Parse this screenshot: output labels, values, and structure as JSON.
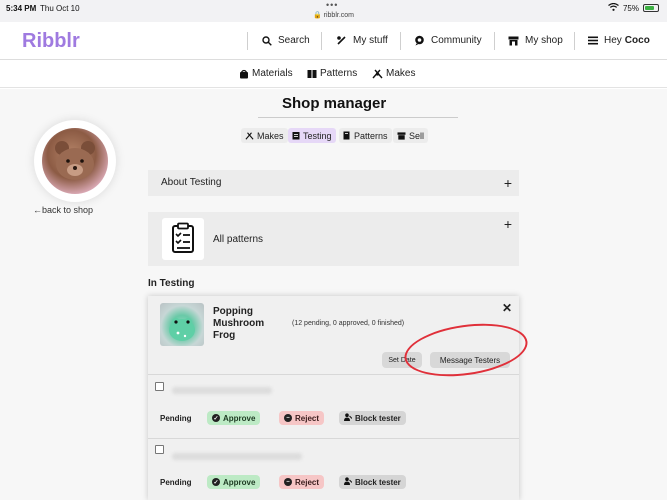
{
  "statusbar": {
    "time": "5:34 PM",
    "date": "Thu Oct 10",
    "url": "ribblr.com",
    "battery": "75%",
    "battery_level": 0.75
  },
  "topnav": {
    "logo": "Ribblr",
    "search": "Search",
    "my_stuff": "My stuff",
    "community": "Community",
    "my_shop": "My shop",
    "hey": "Hey",
    "user": "Coco"
  },
  "subnav": {
    "materials": "Materials",
    "patterns": "Patterns",
    "makes": "Makes"
  },
  "page": {
    "title": "Shop manager",
    "tabs": [
      {
        "label": "Makes"
      },
      {
        "label": "Testing"
      },
      {
        "label": "Patterns"
      },
      {
        "label": "Sell"
      }
    ]
  },
  "profile": {
    "back_link": "←back to shop"
  },
  "sections": {
    "about": "About Testing",
    "all_patterns": "All patterns",
    "in_testing": "In Testing"
  },
  "test_item": {
    "name": "Popping Mushroom Frog",
    "counts": "(12 pending, 0 approved, 0 finished)",
    "set_date": "Set Date",
    "message_testers": "Message Testers"
  },
  "testers": [
    {
      "status": "Pending",
      "approve": "Approve",
      "reject": "Reject",
      "block": "Block tester"
    },
    {
      "status": "Pending",
      "approve": "Approve",
      "reject": "Reject",
      "block": "Block tester"
    }
  ],
  "colors": {
    "brand": "#9f7ae0",
    "annotation": "#e0303a",
    "active_tab": "#e6d8f7"
  }
}
